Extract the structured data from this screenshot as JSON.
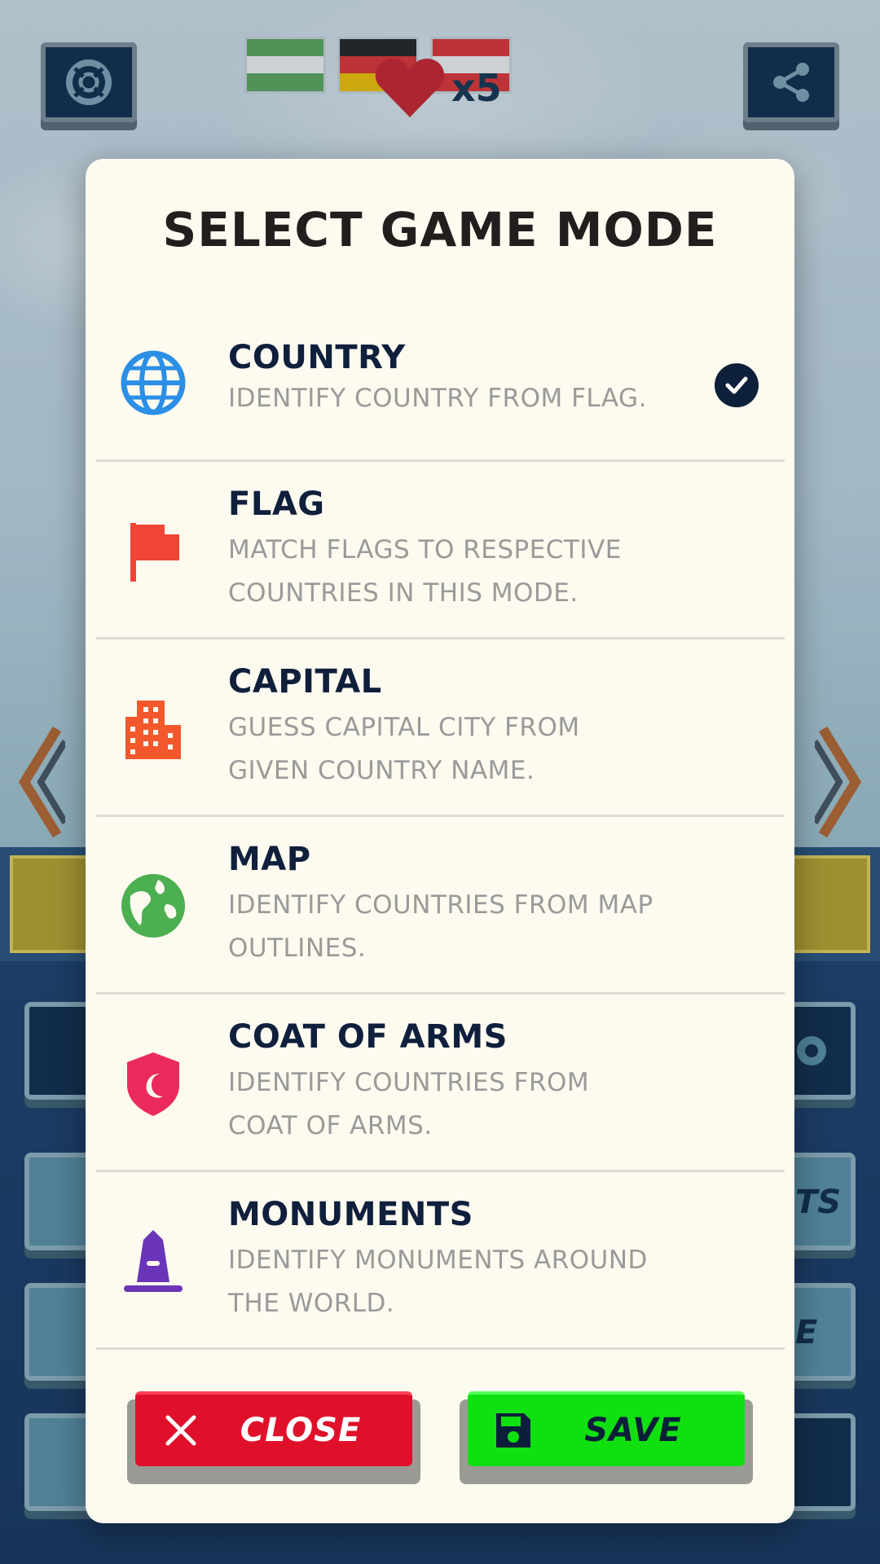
{
  "background": {
    "lives_count": "x5",
    "settings_icon": "lifebuoy-icon",
    "share_icon": "share-icon",
    "tile_partial_label": "TS",
    "tile_partial_label_2": "E"
  },
  "modal": {
    "title": "SELECT GAME MODE",
    "modes": [
      {
        "name": "COUNTRY",
        "desc_line1": "IDENTIFY COUNTRY FROM FLAG.",
        "desc_line2": "",
        "icon": "globe-icon",
        "icon_color": "#2b8fe6",
        "selected": true
      },
      {
        "name": "FLAG",
        "desc_line1": "MATCH FLAGS TO RESPECTIVE",
        "desc_line2": "COUNTRIES IN THIS MODE.",
        "icon": "flag-icon",
        "icon_color": "#f04436",
        "selected": false
      },
      {
        "name": "CAPITAL",
        "desc_line1": "GUESS CAPITAL CITY FROM",
        "desc_line2": "GIVEN COUNTRY NAME.",
        "icon": "building-icon",
        "icon_color": "#f2582b",
        "selected": false
      },
      {
        "name": "MAP",
        "desc_line1": "IDENTIFY COUNTRIES FROM MAP",
        "desc_line2": "OUTLINES.",
        "icon": "earth-icon",
        "icon_color": "#4caf50",
        "selected": false
      },
      {
        "name": "COAT OF ARMS",
        "desc_line1": "IDENTIFY COUNTRIES FROM",
        "desc_line2": "COAT OF ARMS.",
        "icon": "shield-icon",
        "icon_color": "#ea2a5c",
        "selected": false
      },
      {
        "name": "MONUMENTS",
        "desc_line1": "IDENTIFY MONUMENTS AROUND",
        "desc_line2": "THE WORLD.",
        "icon": "monument-icon",
        "icon_color": "#6a35b8",
        "selected": false
      }
    ],
    "close_label": "CLOSE",
    "save_label": "SAVE"
  },
  "colors": {
    "close_button": "#e0102b",
    "save_button": "#10e010",
    "modal_bg": "#fdfaf0",
    "title_text": "#231e1e",
    "mode_name_text": "#0f1f3c",
    "mode_desc_text": "#9a9a9a"
  }
}
